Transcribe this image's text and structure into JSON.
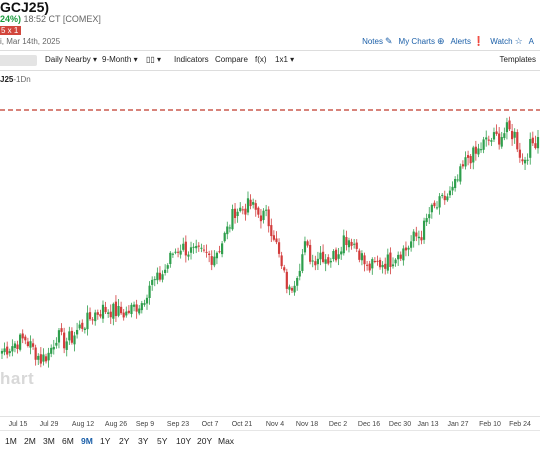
{
  "header": {
    "title": "GCJ25)",
    "change_pct": "24%)",
    "time": "18:52 CT [COMEX]",
    "date": "i, Mar 14th, 2025",
    "red_tag": "5 x 1"
  },
  "actions": [
    "Notes",
    "My Charts",
    "Alerts",
    "Watch",
    "A"
  ],
  "action_icons": [
    "pencil-icon",
    "plus-circle-icon",
    "alert-icon",
    "star-icon"
  ],
  "toolbar": {
    "daily_nearby": "Daily Nearby",
    "period": "9-Month",
    "chart_type_icon": "candle-bars-icon",
    "indicators": "Indicators",
    "compare": "Compare",
    "fx": "f(x)",
    "layout": "1x1",
    "templates": "Templates"
  },
  "symbol_label": {
    "code": "J25",
    "interval": "-1Dn"
  },
  "watermark": "hart",
  "colors": {
    "up": "#2e9e4c",
    "down": "#d23b3b",
    "accent": "#1b5fa8"
  },
  "range_buttons": [
    "1M",
    "2M",
    "3M",
    "6M",
    "9M",
    "1Y",
    "2Y",
    "3Y",
    "5Y",
    "10Y",
    "20Y",
    "Max"
  ],
  "active_range": "9M",
  "chart_data": {
    "type": "candlestick",
    "x_ticks": [
      "Jul 15",
      "Jul 29",
      "Aug 12",
      "Aug 26",
      "Sep 9",
      "Sep 23",
      "Oct 7",
      "Oct 21",
      "Nov 4",
      "Nov 18",
      "Dec 2",
      "Dec 16",
      "Dec 30",
      "Jan 13",
      "Jan 27",
      "Feb 10",
      "Feb 24"
    ],
    "series": [
      {
        "x": "Jul 8",
        "close": 2435
      },
      {
        "x": "Jul 11",
        "close": 2444
      },
      {
        "x": "Jul 15",
        "close": 2455
      },
      {
        "x": "Jul 18",
        "close": 2462
      },
      {
        "x": "Jul 22",
        "close": 2438
      },
      {
        "x": "Jul 25",
        "close": 2416
      },
      {
        "x": "Jul 29",
        "close": 2428
      },
      {
        "x": "Aug 1",
        "close": 2470
      },
      {
        "x": "Aug 5",
        "close": 2455
      },
      {
        "x": "Aug 8",
        "close": 2465
      },
      {
        "x": "Aug 12",
        "close": 2488
      },
      {
        "x": "Aug 15",
        "close": 2503
      },
      {
        "x": "Aug 19",
        "close": 2520
      },
      {
        "x": "Aug 22",
        "close": 2529
      },
      {
        "x": "Aug 26",
        "close": 2527
      },
      {
        "x": "Aug 29",
        "close": 2522
      },
      {
        "x": "Sep 2",
        "close": 2520
      },
      {
        "x": "Sep 5",
        "close": 2534
      },
      {
        "x": "Sep 9",
        "close": 2545
      },
      {
        "x": "Sep 12",
        "close": 2586
      },
      {
        "x": "Sep 16",
        "close": 2595
      },
      {
        "x": "Sep 19",
        "close": 2619
      },
      {
        "x": "Sep 23",
        "close": 2657
      },
      {
        "x": "Sep 26",
        "close": 2672
      },
      {
        "x": "Sep 30",
        "close": 2662
      },
      {
        "x": "Oct 3",
        "close": 2655
      },
      {
        "x": "Oct 7",
        "close": 2655
      },
      {
        "x": "Oct 10",
        "close": 2648
      },
      {
        "x": "Oct 14",
        "close": 2670
      },
      {
        "x": "Oct 17",
        "close": 2708
      },
      {
        "x": "Oct 21",
        "close": 2755
      },
      {
        "x": "Oct 24",
        "close": 2757
      },
      {
        "x": "Oct 28",
        "close": 2765
      },
      {
        "x": "Oct 31",
        "close": 2745
      },
      {
        "x": "Nov 4",
        "close": 2740
      },
      {
        "x": "Nov 7",
        "close": 2700
      },
      {
        "x": "Nov 11",
        "close": 2621
      },
      {
        "x": "Nov 14",
        "close": 2568
      },
      {
        "x": "Nov 18",
        "close": 2616
      },
      {
        "x": "Nov 21",
        "close": 2671
      },
      {
        "x": "Nov 25",
        "close": 2640
      },
      {
        "x": "Nov 28",
        "close": 2658
      },
      {
        "x": "Dec 2",
        "close": 2643
      },
      {
        "x": "Dec 5",
        "close": 2654
      },
      {
        "x": "Dec 9",
        "close": 2692
      },
      {
        "x": "Dec 12",
        "close": 2688
      },
      {
        "x": "Dec 16",
        "close": 2660
      },
      {
        "x": "Dec 19",
        "close": 2620
      },
      {
        "x": "Dec 23",
        "close": 2630
      },
      {
        "x": "Dec 27",
        "close": 2635
      },
      {
        "x": "Dec 30",
        "close": 2641
      },
      {
        "x": "Jan 3",
        "close": 2660
      },
      {
        "x": "Jan 6",
        "close": 2665
      },
      {
        "x": "Jan 9",
        "close": 2690
      },
      {
        "x": "Jan 13",
        "close": 2700
      },
      {
        "x": "Jan 16",
        "close": 2745
      },
      {
        "x": "Jan 20",
        "close": 2762
      },
      {
        "x": "Jan 23",
        "close": 2780
      },
      {
        "x": "Jan 27",
        "close": 2796
      },
      {
        "x": "Jan 30",
        "close": 2835
      },
      {
        "x": "Feb 3",
        "close": 2875
      },
      {
        "x": "Feb 6",
        "close": 2880
      },
      {
        "x": "Feb 10",
        "close": 2905
      },
      {
        "x": "Feb 13",
        "close": 2915
      },
      {
        "x": "Feb 17",
        "close": 2920
      },
      {
        "x": "Feb 20",
        "close": 2935
      },
      {
        "x": "Feb 24",
        "close": 2925
      },
      {
        "x": "Feb 27",
        "close": 2864
      },
      {
        "x": "Mar 3",
        "close": 2898
      },
      {
        "x": "Mar 6",
        "close": 2920
      }
    ],
    "reference_line": "dashed red horizontal line above recent highs",
    "grid": false
  }
}
